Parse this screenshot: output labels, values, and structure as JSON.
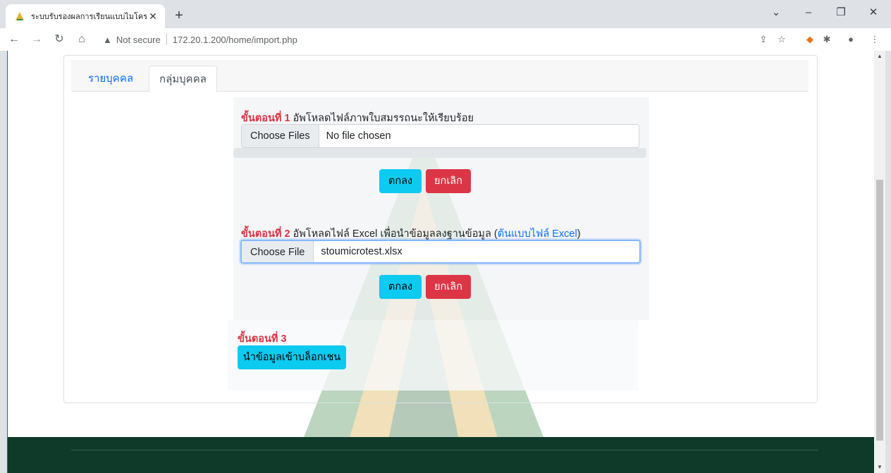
{
  "browser": {
    "tab_title": "ระบบรับรองผลการเรียนแบบไมโครเครดิต",
    "address_warning": "Not secure",
    "url": "172.20.1.200/home/import.php"
  },
  "tabs": {
    "individual": "รายบุคคล",
    "group": "กลุ่มบุคคล"
  },
  "step1": {
    "step": "ขั้นตอนที่ 1",
    "text": "อัพโหลดไฟล์ภาพใบสมรรถนะให้เรียบร้อย",
    "choose_button": "Choose Files",
    "file_name": "No file chosen",
    "ok": "ตกลง",
    "cancel": "ยกเลิก"
  },
  "step2": {
    "step": "ขั้นตอนที่ 2",
    "text": "อัพโหลดไฟล์ Excel เพื่อนำข้อมูลลงฐานข้อมูล (",
    "template_link": "ต้นแบบไฟล์ Excel",
    "text_end": ")",
    "choose_button": "Choose File",
    "file_name": "stoumicrotest.xlsx",
    "ok": "ตกลง",
    "cancel": "ยกเลิก"
  },
  "step3": {
    "step": "ขั้นตอนที่ 3",
    "blockchain_button": "นำข้อมูลเข้าบล็อกเชน"
  },
  "colors": {
    "primary_link": "#0d6efd",
    "info": "#0dcaf0",
    "danger": "#dc3545",
    "footer": "#0f3a2a"
  }
}
